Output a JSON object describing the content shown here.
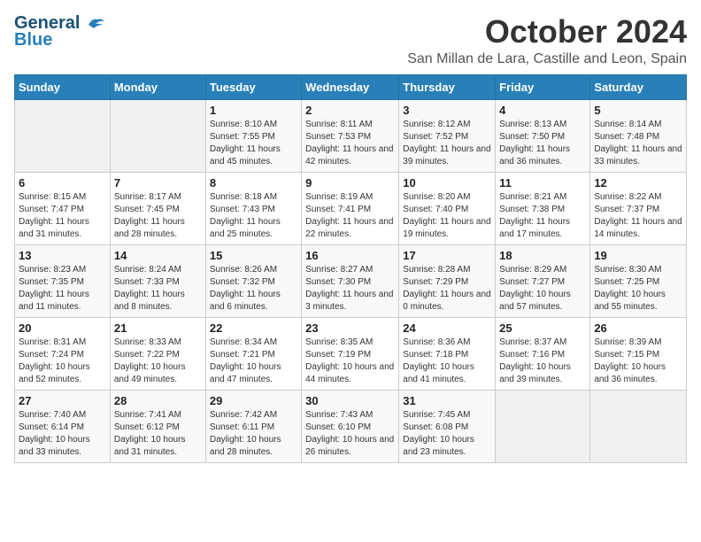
{
  "logo": {
    "line1": "General",
    "line2": "Blue"
  },
  "title": "October 2024",
  "location": "San Millan de Lara, Castille and Leon, Spain",
  "days_of_week": [
    "Sunday",
    "Monday",
    "Tuesday",
    "Wednesday",
    "Thursday",
    "Friday",
    "Saturday"
  ],
  "weeks": [
    [
      {
        "day": "",
        "info": ""
      },
      {
        "day": "",
        "info": ""
      },
      {
        "day": "1",
        "info": "Sunrise: 8:10 AM\nSunset: 7:55 PM\nDaylight: 11 hours and 45 minutes."
      },
      {
        "day": "2",
        "info": "Sunrise: 8:11 AM\nSunset: 7:53 PM\nDaylight: 11 hours and 42 minutes."
      },
      {
        "day": "3",
        "info": "Sunrise: 8:12 AM\nSunset: 7:52 PM\nDaylight: 11 hours and 39 minutes."
      },
      {
        "day": "4",
        "info": "Sunrise: 8:13 AM\nSunset: 7:50 PM\nDaylight: 11 hours and 36 minutes."
      },
      {
        "day": "5",
        "info": "Sunrise: 8:14 AM\nSunset: 7:48 PM\nDaylight: 11 hours and 33 minutes."
      }
    ],
    [
      {
        "day": "6",
        "info": "Sunrise: 8:15 AM\nSunset: 7:47 PM\nDaylight: 11 hours and 31 minutes."
      },
      {
        "day": "7",
        "info": "Sunrise: 8:17 AM\nSunset: 7:45 PM\nDaylight: 11 hours and 28 minutes."
      },
      {
        "day": "8",
        "info": "Sunrise: 8:18 AM\nSunset: 7:43 PM\nDaylight: 11 hours and 25 minutes."
      },
      {
        "day": "9",
        "info": "Sunrise: 8:19 AM\nSunset: 7:41 PM\nDaylight: 11 hours and 22 minutes."
      },
      {
        "day": "10",
        "info": "Sunrise: 8:20 AM\nSunset: 7:40 PM\nDaylight: 11 hours and 19 minutes."
      },
      {
        "day": "11",
        "info": "Sunrise: 8:21 AM\nSunset: 7:38 PM\nDaylight: 11 hours and 17 minutes."
      },
      {
        "day": "12",
        "info": "Sunrise: 8:22 AM\nSunset: 7:37 PM\nDaylight: 11 hours and 14 minutes."
      }
    ],
    [
      {
        "day": "13",
        "info": "Sunrise: 8:23 AM\nSunset: 7:35 PM\nDaylight: 11 hours and 11 minutes."
      },
      {
        "day": "14",
        "info": "Sunrise: 8:24 AM\nSunset: 7:33 PM\nDaylight: 11 hours and 8 minutes."
      },
      {
        "day": "15",
        "info": "Sunrise: 8:26 AM\nSunset: 7:32 PM\nDaylight: 11 hours and 6 minutes."
      },
      {
        "day": "16",
        "info": "Sunrise: 8:27 AM\nSunset: 7:30 PM\nDaylight: 11 hours and 3 minutes."
      },
      {
        "day": "17",
        "info": "Sunrise: 8:28 AM\nSunset: 7:29 PM\nDaylight: 11 hours and 0 minutes."
      },
      {
        "day": "18",
        "info": "Sunrise: 8:29 AM\nSunset: 7:27 PM\nDaylight: 10 hours and 57 minutes."
      },
      {
        "day": "19",
        "info": "Sunrise: 8:30 AM\nSunset: 7:25 PM\nDaylight: 10 hours and 55 minutes."
      }
    ],
    [
      {
        "day": "20",
        "info": "Sunrise: 8:31 AM\nSunset: 7:24 PM\nDaylight: 10 hours and 52 minutes."
      },
      {
        "day": "21",
        "info": "Sunrise: 8:33 AM\nSunset: 7:22 PM\nDaylight: 10 hours and 49 minutes."
      },
      {
        "day": "22",
        "info": "Sunrise: 8:34 AM\nSunset: 7:21 PM\nDaylight: 10 hours and 47 minutes."
      },
      {
        "day": "23",
        "info": "Sunrise: 8:35 AM\nSunset: 7:19 PM\nDaylight: 10 hours and 44 minutes."
      },
      {
        "day": "24",
        "info": "Sunrise: 8:36 AM\nSunset: 7:18 PM\nDaylight: 10 hours and 41 minutes."
      },
      {
        "day": "25",
        "info": "Sunrise: 8:37 AM\nSunset: 7:16 PM\nDaylight: 10 hours and 39 minutes."
      },
      {
        "day": "26",
        "info": "Sunrise: 8:39 AM\nSunset: 7:15 PM\nDaylight: 10 hours and 36 minutes."
      }
    ],
    [
      {
        "day": "27",
        "info": "Sunrise: 7:40 AM\nSunset: 6:14 PM\nDaylight: 10 hours and 33 minutes."
      },
      {
        "day": "28",
        "info": "Sunrise: 7:41 AM\nSunset: 6:12 PM\nDaylight: 10 hours and 31 minutes."
      },
      {
        "day": "29",
        "info": "Sunrise: 7:42 AM\nSunset: 6:11 PM\nDaylight: 10 hours and 28 minutes."
      },
      {
        "day": "30",
        "info": "Sunrise: 7:43 AM\nSunset: 6:10 PM\nDaylight: 10 hours and 26 minutes."
      },
      {
        "day": "31",
        "info": "Sunrise: 7:45 AM\nSunset: 6:08 PM\nDaylight: 10 hours and 23 minutes."
      },
      {
        "day": "",
        "info": ""
      },
      {
        "day": "",
        "info": ""
      }
    ]
  ]
}
